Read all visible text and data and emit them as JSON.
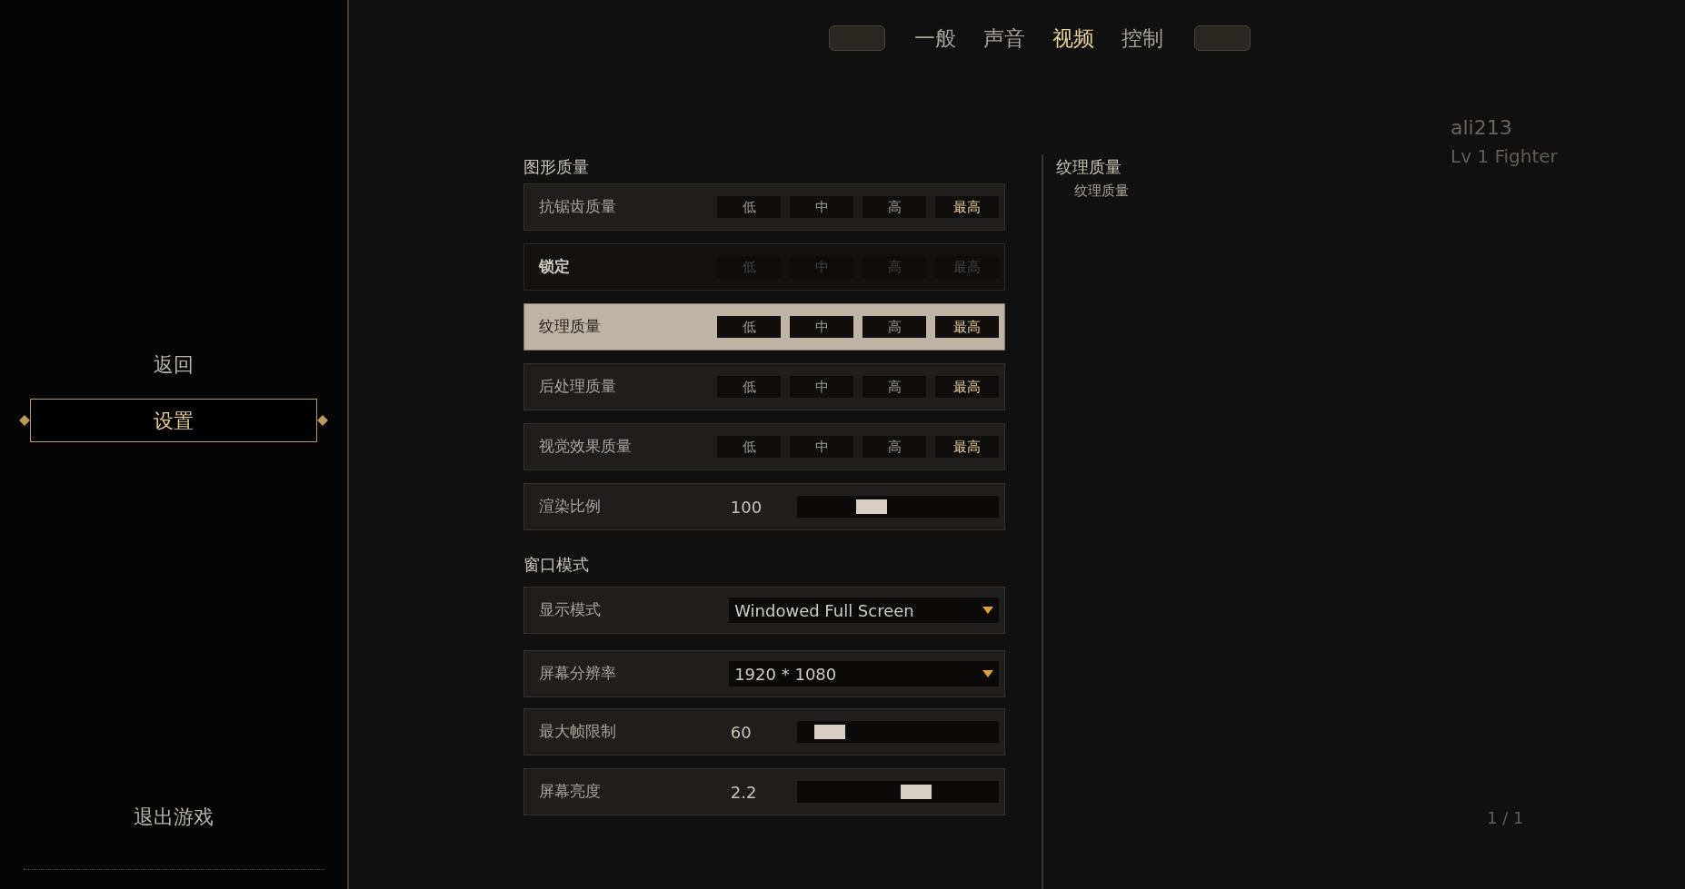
{
  "menu": [
    {
      "label": "返回",
      "selected": false
    },
    {
      "label": "设置",
      "selected": true
    },
    {
      "label": "退出游戏",
      "selected": false
    }
  ],
  "tabs": [
    {
      "label": "一般",
      "selected": false
    },
    {
      "label": "声音",
      "selected": false
    },
    {
      "label": "视频",
      "selected": true
    },
    {
      "label": "控制",
      "selected": false
    }
  ],
  "sections": [
    {
      "title": "图形质量",
      "rows": [
        {
          "kind": "options",
          "label": "抗锯齿质量",
          "highlighted": false,
          "disabled": false,
          "options": [
            {
              "label": "低",
              "selected": false
            },
            {
              "label": "中",
              "selected": false
            },
            {
              "label": "高",
              "selected": false
            },
            {
              "label": "最高",
              "selected": true
            }
          ]
        },
        {
          "kind": "options",
          "label": "锁定",
          "highlighted": false,
          "disabled": true,
          "options": [
            {
              "label": "低",
              "selected": false
            },
            {
              "label": "中",
              "selected": false
            },
            {
              "label": "高",
              "selected": false
            },
            {
              "label": "最高",
              "selected": false
            }
          ]
        },
        {
          "kind": "options",
          "label": "纹理质量",
          "highlighted": true,
          "disabled": false,
          "options": [
            {
              "label": "低",
              "selected": false
            },
            {
              "label": "中",
              "selected": false
            },
            {
              "label": "高",
              "selected": false
            },
            {
              "label": "最高",
              "selected": true
            }
          ]
        },
        {
          "kind": "options",
          "label": "后处理质量",
          "highlighted": false,
          "disabled": false,
          "options": [
            {
              "label": "低",
              "selected": false
            },
            {
              "label": "中",
              "selected": false
            },
            {
              "label": "高",
              "selected": false
            },
            {
              "label": "最高",
              "selected": true
            }
          ]
        },
        {
          "kind": "options",
          "label": "视觉效果质量",
          "highlighted": false,
          "disabled": false,
          "options": [
            {
              "label": "低",
              "selected": false
            },
            {
              "label": "中",
              "selected": false
            },
            {
              "label": "高",
              "selected": false
            },
            {
              "label": "最高",
              "selected": true
            }
          ]
        },
        {
          "kind": "slider",
          "label": "渲染比例",
          "highlighted": false,
          "disabled": false,
          "reading": "100",
          "level": 0.34
        }
      ]
    },
    {
      "title": "窗口模式",
      "rows": [
        {
          "kind": "dropdown",
          "label": "显示模式",
          "highlighted": false,
          "disabled": false,
          "value": "Windowed Full Screen"
        },
        {
          "kind": "dropdown",
          "label": "屏幕分辨率",
          "highlighted": false,
          "disabled": false,
          "value": "1920 * 1080"
        },
        {
          "kind": "slider",
          "label": "最大帧限制",
          "highlighted": false,
          "disabled": false,
          "reading": "60",
          "level": 0.1
        },
        {
          "kind": "slider",
          "label": "屏幕亮度",
          "highlighted": false,
          "disabled": false,
          "reading": "2.2",
          "level": 0.6
        }
      ]
    }
  ],
  "description": {
    "title": "纹理质量",
    "text": "纹理质量"
  },
  "character": {
    "name": "ali213",
    "info": "Lv 1 Fighter",
    "page": "1 / 1"
  }
}
